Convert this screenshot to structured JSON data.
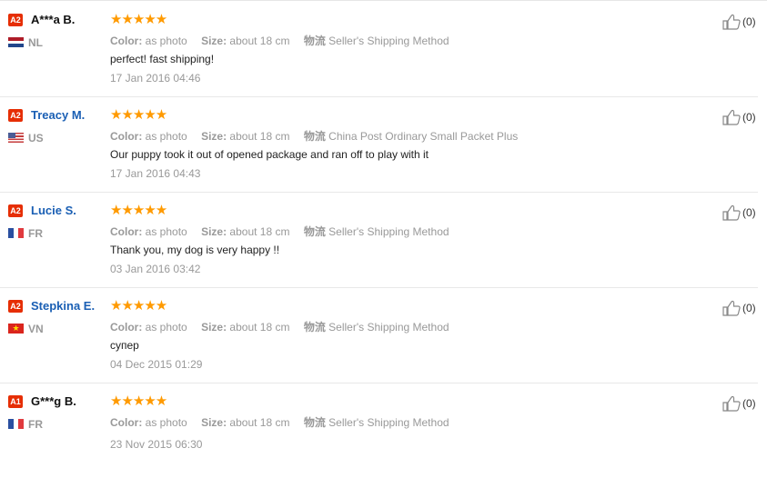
{
  "reviews": [
    {
      "level": "A2",
      "name": "A***a B.",
      "name_style": "dark",
      "country": "NL",
      "flag": "nl",
      "stars": "★★★★★",
      "color_label": "Color:",
      "color_value": "as photo",
      "size_label": "Size:",
      "size_value": "about 18 cm",
      "shipping_label": "物流",
      "shipping_value": "Seller's Shipping Method",
      "feedback": "perfect! fast shipping!",
      "date": "17 Jan 2016 04:46",
      "helpful": "(0)"
    },
    {
      "level": "A2",
      "name": "Treacy M.",
      "name_style": "blue",
      "country": "US",
      "flag": "us",
      "stars": "★★★★★",
      "color_label": "Color:",
      "color_value": "as photo",
      "size_label": "Size:",
      "size_value": "about 18 cm",
      "shipping_label": "物流",
      "shipping_value": "China Post Ordinary Small Packet Plus",
      "feedback": "Our puppy took it out of opened package and ran off to play with it",
      "date": "17 Jan 2016 04:43",
      "helpful": "(0)"
    },
    {
      "level": "A2",
      "name": "Lucie S.",
      "name_style": "blue",
      "country": "FR",
      "flag": "fr",
      "stars": "★★★★★",
      "color_label": "Color:",
      "color_value": "as photo",
      "size_label": "Size:",
      "size_value": "about 18 cm",
      "shipping_label": "物流",
      "shipping_value": "Seller's Shipping Method",
      "feedback": "Thank you, my dog is very happy !!",
      "date": "03 Jan 2016 03:42",
      "helpful": "(0)"
    },
    {
      "level": "A2",
      "name": "Stepkina E.",
      "name_style": "blue",
      "country": "VN",
      "flag": "vn",
      "stars": "★★★★★",
      "color_label": "Color:",
      "color_value": "as photo",
      "size_label": "Size:",
      "size_value": "about 18 cm",
      "shipping_label": "物流",
      "shipping_value": "Seller's Shipping Method",
      "feedback": "супер",
      "date": "04 Dec 2015 01:29",
      "helpful": "(0)"
    },
    {
      "level": "A1",
      "name": "G***g B.",
      "name_style": "dark",
      "country": "FR",
      "flag": "fr",
      "stars": "★★★★★",
      "color_label": "Color:",
      "color_value": "as photo",
      "size_label": "Size:",
      "size_value": "about 18 cm",
      "shipping_label": "物流",
      "shipping_value": "Seller's Shipping Method",
      "feedback": "",
      "date": "23 Nov 2015 06:30",
      "helpful": "(0)"
    }
  ],
  "colors": {
    "accent_badge": "#e62e04",
    "star": "#ff9a00",
    "link_blue": "#1a5fb4",
    "muted": "#999999"
  },
  "icons": {
    "helpful": "thumbs-up-icon"
  }
}
